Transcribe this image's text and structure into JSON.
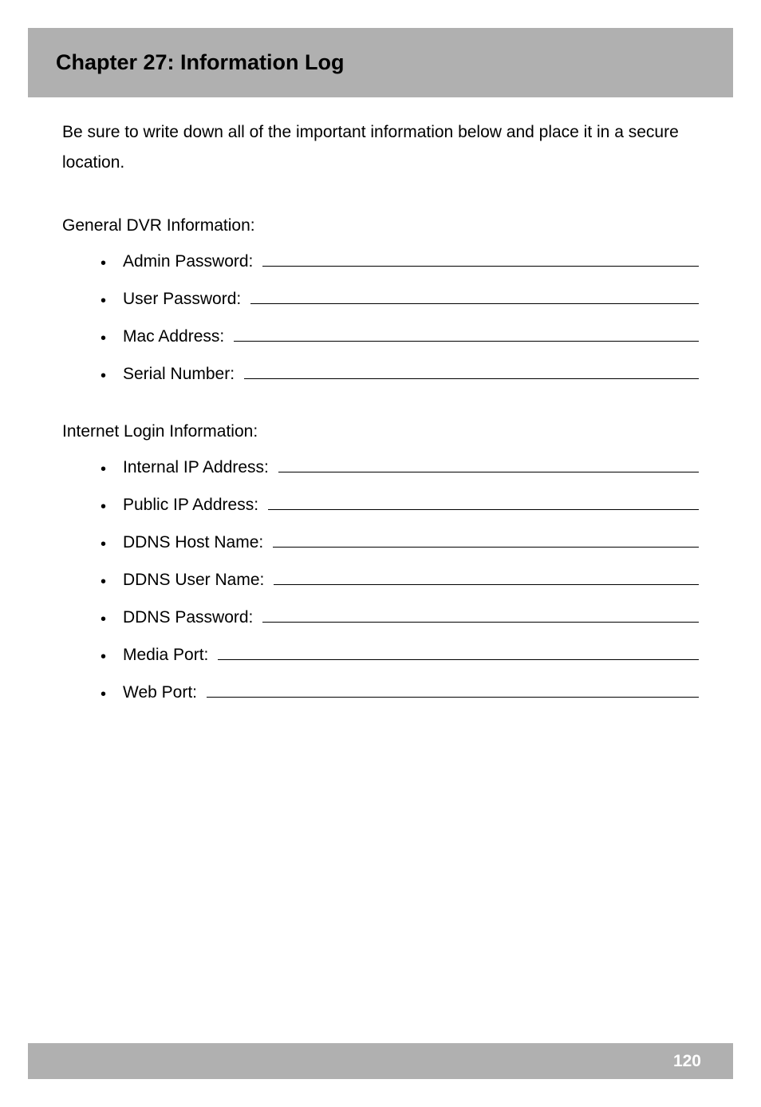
{
  "header": {
    "title": "Chapter 27: Information Log"
  },
  "intro": "Be sure to write down all of the important information below and place it in a secure location.",
  "sections": [
    {
      "heading": "General DVR Information:",
      "items": [
        "Admin Password:",
        "User Password:",
        "Mac Address:",
        "Serial Number:"
      ]
    },
    {
      "heading": "Internet Login Information:",
      "items": [
        "Internal IP Address:",
        "Public IP Address:",
        "DDNS Host Name:",
        "DDNS User Name:",
        "DDNS Password:",
        "Media Port:",
        "Web Port:"
      ]
    }
  ],
  "footer": {
    "page_number": "120"
  }
}
